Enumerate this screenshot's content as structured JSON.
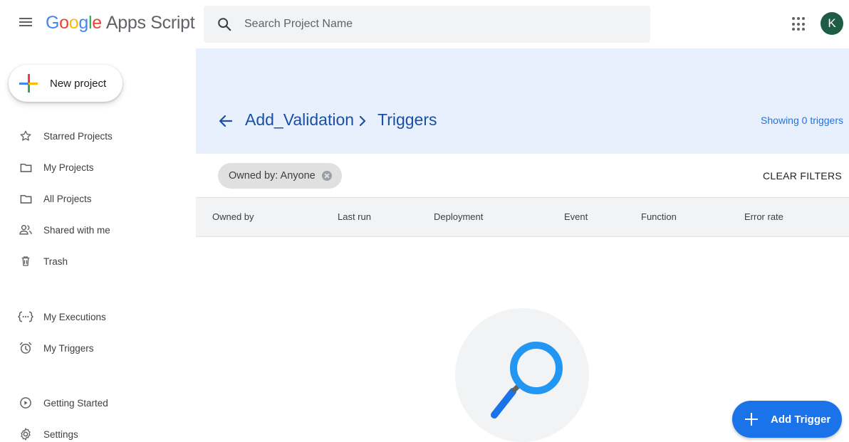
{
  "header": {
    "brand_google": [
      "G",
      "o",
      "o",
      "g",
      "l",
      "e"
    ],
    "brand_product": "Apps Script",
    "search_placeholder": "Search Project Name",
    "avatar_letter": "K",
    "avatar_color": "#1e5c45"
  },
  "sidebar": {
    "new_project_label": "New project",
    "items": [
      {
        "label": "Starred Projects",
        "icon": "star-icon"
      },
      {
        "label": "My Projects",
        "icon": "folder-icon"
      },
      {
        "label": "All Projects",
        "icon": "folder-icon"
      },
      {
        "label": "Shared with me",
        "icon": "people-icon"
      },
      {
        "label": "Trash",
        "icon": "trash-icon"
      },
      {
        "label": "My Executions",
        "icon": "executions-icon"
      },
      {
        "label": "My Triggers",
        "icon": "alarm-clock-icon"
      },
      {
        "label": "Getting Started",
        "icon": "play-circle-icon"
      },
      {
        "label": "Settings",
        "icon": "gear-icon"
      }
    ]
  },
  "main": {
    "breadcrumb_project": "Add_Validation",
    "breadcrumb_current": "Triggers",
    "showing_text": "Showing 0 triggers",
    "filter_chip": "Owned by: Anyone",
    "clear_filters": "CLEAR FILTERS",
    "columns": [
      "Owned by",
      "Last run",
      "Deployment",
      "Event",
      "Function",
      "Error rate"
    ],
    "add_trigger_label": "Add Trigger"
  },
  "colors": {
    "accent": "#1a73e8",
    "banner": "#e8f0fe",
    "breadcrumb": "#1a4fa3"
  }
}
